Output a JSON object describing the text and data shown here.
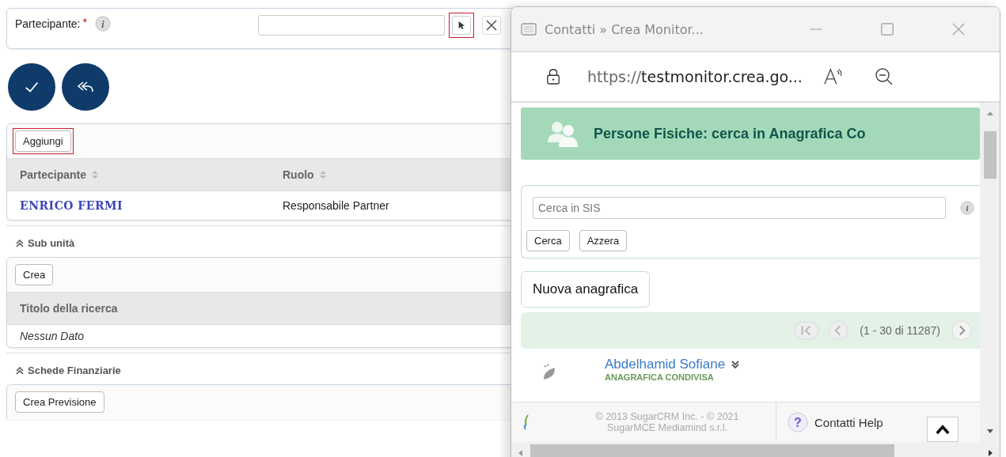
{
  "participant_field": {
    "label": "Partecipante:",
    "required_mark": "*",
    "info_glyph": "i",
    "select_highlighted": true
  },
  "actions": [
    {
      "kind": "save"
    },
    {
      "kind": "back"
    }
  ],
  "participants": {
    "add_button": "Aggiungi",
    "add_highlighted": true,
    "columns": [
      "Partecipante",
      "Ruolo"
    ],
    "rows": [
      {
        "name": "ENRICO FERMI",
        "role": "Responsabile Partner"
      }
    ]
  },
  "sub_units": {
    "heading": "Sub unità",
    "create_button": "Crea",
    "columns": [
      "Titolo della ricerca"
    ],
    "empty": "Nessun Dato"
  },
  "financial": {
    "heading": "Schede Finanziarie",
    "create_button": "Crea Previsione"
  },
  "popup": {
    "title": "Contatti » Crea Monitor...",
    "url_scheme": "https://",
    "url_host": "testmonitor.crea.go...",
    "banner": "Persone Fisiche: cerca in Anagrafica Co",
    "search": {
      "placeholder": "Cerca in SIS",
      "info_glyph": "i",
      "buttons": [
        "Cerca",
        "Azzera"
      ]
    },
    "new_button": "Nuova anagrafica",
    "pager": "(1 - 30 di 11287)",
    "records": [
      {
        "name": "Abdelhamid Sofiane",
        "tag": "ANAGRAFICA CONDIVISA"
      }
    ],
    "footer": {
      "copyright": [
        "© 2013 SugarCRM Inc. - © 2021",
        "SugarMCE Mediamind s.r.l."
      ],
      "help_glyph": "?",
      "help": "Contatti Help"
    }
  }
}
